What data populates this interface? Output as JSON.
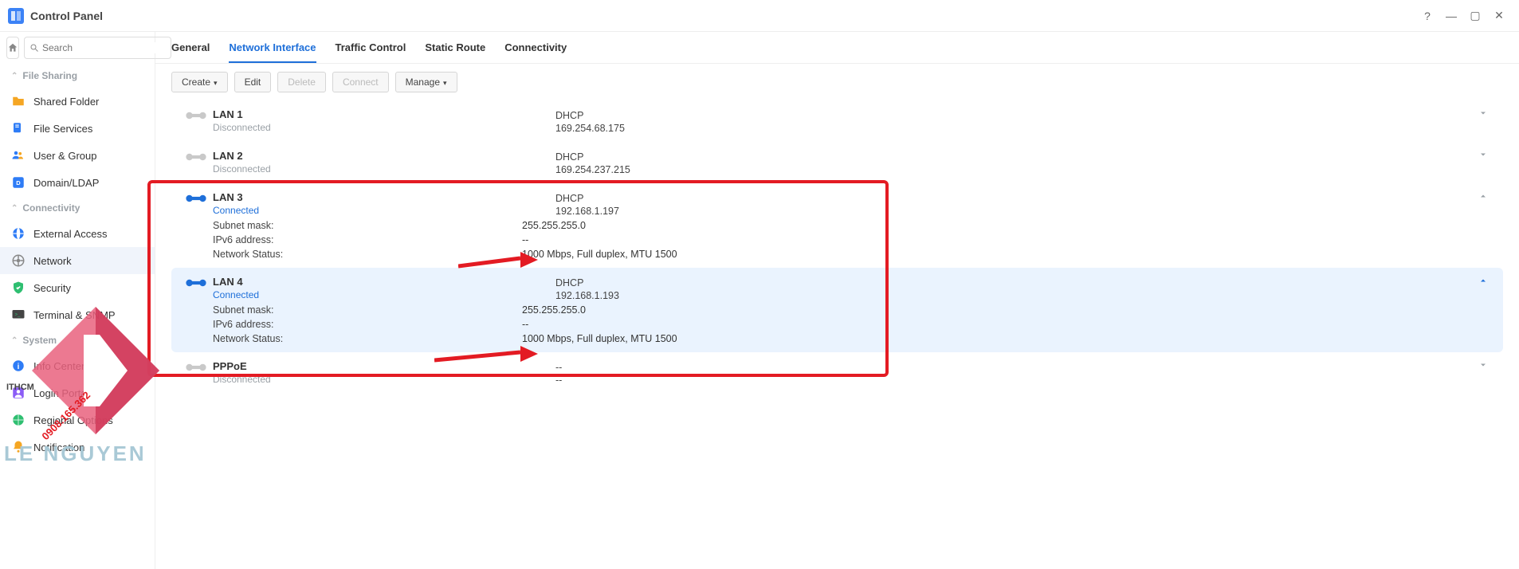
{
  "window": {
    "title": "Control Panel"
  },
  "search": {
    "placeholder": "Search"
  },
  "sidebar": {
    "sections": [
      {
        "label": "File Sharing",
        "items": [
          {
            "label": "Shared Folder"
          },
          {
            "label": "File Services"
          },
          {
            "label": "User & Group"
          },
          {
            "label": "Domain/LDAP"
          }
        ]
      },
      {
        "label": "Connectivity",
        "items": [
          {
            "label": "External Access"
          },
          {
            "label": "Network"
          },
          {
            "label": "Security"
          },
          {
            "label": "Terminal & SNMP"
          }
        ]
      },
      {
        "label": "System",
        "items": [
          {
            "label": "Info Center"
          },
          {
            "label": "Login Portal"
          },
          {
            "label": "Regional Options"
          },
          {
            "label": "Notification"
          }
        ]
      }
    ]
  },
  "tabs": [
    {
      "label": "General"
    },
    {
      "label": "Network Interface"
    },
    {
      "label": "Traffic Control"
    },
    {
      "label": "Static Route"
    },
    {
      "label": "Connectivity"
    }
  ],
  "toolbar": {
    "create": "Create",
    "edit": "Edit",
    "delete": "Delete",
    "connect": "Connect",
    "manage": "Manage"
  },
  "ifaces": [
    {
      "name": "LAN 1",
      "status": "Disconnected",
      "mode": "DHCP",
      "ip": "169.254.68.175"
    },
    {
      "name": "LAN 2",
      "status": "Disconnected",
      "mode": "DHCP",
      "ip": "169.254.237.215"
    },
    {
      "name": "LAN 3",
      "status": "Connected",
      "mode": "DHCP",
      "ip": "192.168.1.197",
      "subnet_k": "Subnet mask:",
      "subnet_v": "255.255.255.0",
      "ipv6_k": "IPv6 address:",
      "ipv6_v": "--",
      "netstat_k": "Network Status:",
      "netstat_v": "1000 Mbps, Full duplex, MTU 1500"
    },
    {
      "name": "LAN 4",
      "status": "Connected",
      "mode": "DHCP",
      "ip": "192.168.1.193",
      "subnet_k": "Subnet mask:",
      "subnet_v": "255.255.255.0",
      "ipv6_k": "IPv6 address:",
      "ipv6_v": "--",
      "netstat_k": "Network Status:",
      "netstat_v": "1000 Mbps, Full duplex, MTU 1500"
    },
    {
      "name": "PPPoE",
      "status": "Disconnected",
      "mode": "--",
      "ip": "--"
    }
  ],
  "watermark": {
    "brand": "LE NGUYEN",
    "site": "ITHCM",
    "phone": "0908.165.362"
  }
}
